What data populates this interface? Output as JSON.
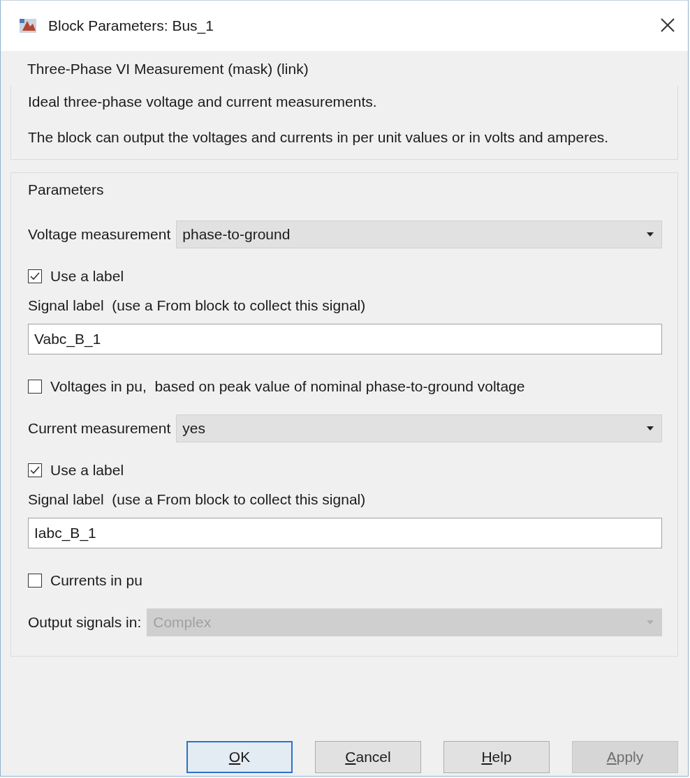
{
  "window": {
    "title": "Block Parameters: Bus_1"
  },
  "mask_title": "Three-Phase VI Measurement (mask) (link)",
  "description": [
    "Ideal three-phase voltage and current measurements.",
    "The block can output the voltages and currents in per unit values or in volts and amperes."
  ],
  "parameters": {
    "title": "Parameters",
    "items": [
      {
        "kind": "dropdown",
        "label": "Voltage measurement",
        "value": "phase-to-ground",
        "disabled": false
      },
      {
        "kind": "checkbox",
        "label": "Use a label",
        "checked": true
      },
      {
        "kind": "text",
        "label": "Signal label  (use a From block to collect this signal)"
      },
      {
        "kind": "input",
        "value": "Vabc_B_1"
      },
      {
        "kind": "checkbox",
        "label": "Voltages in pu,  based on peak value of nominal phase-to-ground voltage",
        "checked": false
      },
      {
        "kind": "dropdown",
        "label": "Current measurement",
        "value": "yes",
        "disabled": false
      },
      {
        "kind": "checkbox",
        "label": "Use a label",
        "checked": true
      },
      {
        "kind": "text",
        "label": "Signal label  (use a From block to collect this signal)"
      },
      {
        "kind": "input",
        "value": "Iabc_B_1"
      },
      {
        "kind": "checkbox",
        "label": "Currents in pu",
        "checked": false
      },
      {
        "kind": "dropdown",
        "label": "Output signals in:",
        "value": "Complex",
        "disabled": true
      }
    ]
  },
  "buttons": [
    {
      "label": "OK",
      "default": true,
      "disabled": false
    },
    {
      "label": "Cancel",
      "default": false,
      "disabled": false
    },
    {
      "label": "Help",
      "default": false,
      "disabled": false
    },
    {
      "label": "Apply",
      "default": false,
      "disabled": true
    }
  ]
}
